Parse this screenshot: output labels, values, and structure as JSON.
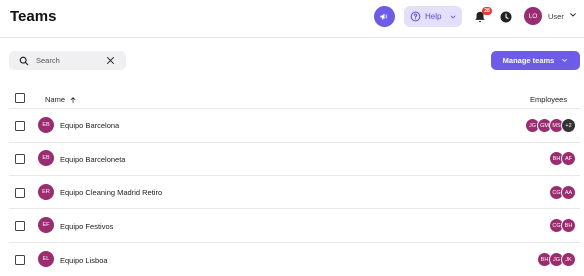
{
  "header": {
    "title": "Teams",
    "help_label": "Help",
    "notification_count": "28",
    "user_initials": "LO",
    "user_label": "User",
    "colors": {
      "accent": "#6c5ce7",
      "accent_light": "#e4e0fb",
      "avatar": "#9b2c6f",
      "badge": "#e53935"
    }
  },
  "toolbar": {
    "search_placeholder": "Search",
    "manage_label": "Manage teams"
  },
  "table": {
    "columns": {
      "name": "Name",
      "employees": "Employees"
    },
    "rows": [
      {
        "initials": "EB",
        "name": "Equipo Barcelona",
        "employees": [
          "JG",
          "GM",
          "MS",
          "+2"
        ]
      },
      {
        "initials": "EB",
        "name": "Equipo Barceloneta",
        "employees": [
          "BH",
          "AF"
        ]
      },
      {
        "initials": "ER",
        "name": "Equipo Cleaning Madrid Retiro",
        "employees": [
          "CG",
          "AA"
        ]
      },
      {
        "initials": "EF",
        "name": "Equipo Festivos",
        "employees": [
          "CG",
          "BH"
        ]
      },
      {
        "initials": "EL",
        "name": "Equipo Lisboa",
        "employees": [
          "BH",
          "JG",
          "JK"
        ]
      }
    ]
  }
}
